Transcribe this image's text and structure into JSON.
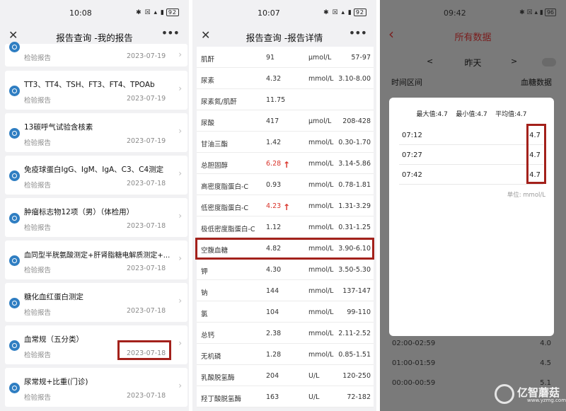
{
  "panel1": {
    "status": {
      "time": "10:08",
      "battery": "92"
    },
    "title": "报告查询 -我的报告",
    "reports": [
      {
        "name": "",
        "type": "检验报告",
        "date": "2023-07-19"
      },
      {
        "name": "TT3、TT4、TSH、FT3、FT4、TPOAb",
        "type": "检验报告",
        "date": "2023-07-19"
      },
      {
        "name": "13碳呼气试验含核素",
        "type": "检验报告",
        "date": "2023-07-19"
      },
      {
        "name": "免疫球蛋白IgG、IgM、IgA、C3、C4测定",
        "type": "检验报告",
        "date": "2023-07-18"
      },
      {
        "name": "肿瘤标志物12项（男）（体检用）",
        "type": "检验报告",
        "date": "2023-07-18"
      },
      {
        "name": "血同型半胱氨酸测定+肝肾脂糖电解质测定+...",
        "type": "检验报告",
        "date": "2023-07-18"
      },
      {
        "name": "糖化血红蛋白测定",
        "type": "检验报告",
        "date": "2023-07-18"
      },
      {
        "name": "血常规（五分类）",
        "type": "检验报告",
        "date": "2023-07-18"
      },
      {
        "name": "尿常规+比重(门诊)",
        "type": "检验报告",
        "date": "2023-07-18"
      }
    ]
  },
  "panel2": {
    "status": {
      "time": "10:07",
      "battery": "92"
    },
    "title": "报告查询 -报告详情",
    "rows": [
      {
        "item": "肌酐",
        "value": "91",
        "unit": "μmol/L",
        "range": "57-97",
        "high": false
      },
      {
        "item": "尿素",
        "value": "4.32",
        "unit": "mmol/L",
        "range": "3.10-8.00",
        "high": false
      },
      {
        "item": "尿素氮/肌酐",
        "value": "11.75",
        "unit": "",
        "range": "",
        "high": false
      },
      {
        "item": "尿酸",
        "value": "417",
        "unit": "μmol/L",
        "range": "208-428",
        "high": false
      },
      {
        "item": "甘油三酯",
        "value": "1.42",
        "unit": "mmol/L",
        "range": "0.30-1.70",
        "high": false
      },
      {
        "item": "总胆固醇",
        "value": "6.28",
        "unit": "mmol/L",
        "range": "3.14-5.86",
        "high": true
      },
      {
        "item": "高密度脂蛋白-C",
        "value": "0.93",
        "unit": "mmol/L",
        "range": "0.78-1.81",
        "high": false
      },
      {
        "item": "低密度脂蛋白-C",
        "value": "4.23",
        "unit": "mmol/L",
        "range": "1.31-3.29",
        "high": true
      },
      {
        "item": "极低密度脂蛋白-C",
        "value": "1.12",
        "unit": "mmol/L",
        "range": "0.31-1.25",
        "high": false
      },
      {
        "item": "空腹血糖",
        "value": "4.82",
        "unit": "mmol/L",
        "range": "3.90-6.10",
        "high": false
      },
      {
        "item": "钾",
        "value": "4.30",
        "unit": "mmol/L",
        "range": "3.50-5.30",
        "high": false
      },
      {
        "item": "钠",
        "value": "144",
        "unit": "mmol/L",
        "range": "137-147",
        "high": false
      },
      {
        "item": "氯",
        "value": "104",
        "unit": "mmol/L",
        "range": "99-110",
        "high": false
      },
      {
        "item": "总钙",
        "value": "2.38",
        "unit": "mmol/L",
        "range": "2.11-2.52",
        "high": false
      },
      {
        "item": "无机磷",
        "value": "1.28",
        "unit": "mmol/L",
        "range": "0.85-1.51",
        "high": false
      },
      {
        "item": "乳酸脱氢酶",
        "value": "204",
        "unit": "U/L",
        "range": "120-250",
        "high": false
      },
      {
        "item": "羟丁酸脱氢酶",
        "value": "163",
        "unit": "U/L",
        "range": "72-182",
        "high": false
      }
    ]
  },
  "panel3": {
    "status": {
      "time": "09:42",
      "battery": "96"
    },
    "title": "所有数据",
    "day": "昨天",
    "prev": "<",
    "next": ">",
    "col_time": "时间区间",
    "col_value": "血糖数据",
    "modal": {
      "max_label": "最大值:",
      "max": "4.7",
      "min_label": "最小值:",
      "min": "4.7",
      "avg_label": "平均值:",
      "avg": "4.7",
      "rows": [
        {
          "time": "07:12",
          "value": "4.7"
        },
        {
          "time": "07:27",
          "value": "4.7"
        },
        {
          "time": "07:42",
          "value": "4.7"
        }
      ],
      "unit": "单位: mmol/L"
    },
    "below": [
      {
        "time": "02:00-02:59",
        "value": "4.0"
      },
      {
        "time": "01:00-01:59",
        "value": "4.5"
      },
      {
        "time": "00:00-00:59",
        "value": "5.1"
      }
    ],
    "watermark": {
      "name": "亿智蘑菇",
      "url": "www.yzmg.com"
    }
  },
  "colors": {
    "highlight": "#a3211b",
    "accent": "#2f7ec2",
    "high_value": "#d9342b",
    "panel3_title": "#7a1d1d"
  }
}
